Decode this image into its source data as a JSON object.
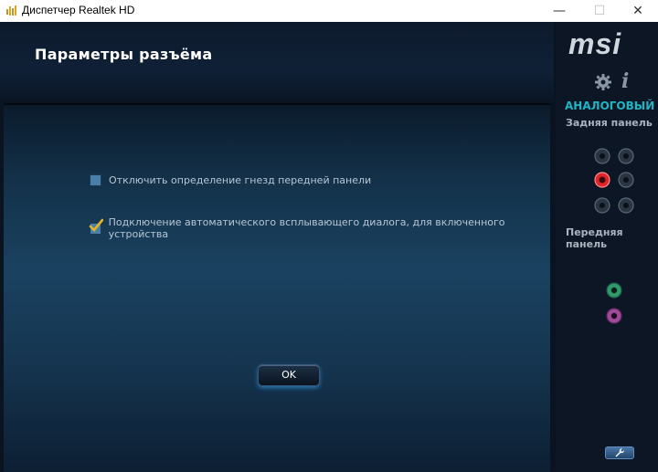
{
  "window": {
    "title": "Диспетчер Realtek HD",
    "controls": {
      "minimize": "—",
      "maximize": "☐",
      "close": "✕"
    }
  },
  "header": {
    "title": "Параметры разъёма"
  },
  "options": [
    {
      "label": "Отключить определение гнезд передней панели",
      "checked": false
    },
    {
      "label": "Подключение автоматического всплывающего диалога, для включенного устройства",
      "checked": true
    }
  ],
  "ok_button": {
    "label": "OK"
  },
  "side_panel": {
    "logo": "msi",
    "settings_icon": "gear-icon",
    "info_icon": "i",
    "section_title": "АНАЛОГОВЫЙ",
    "rear_panel_label": "Задняя панель",
    "front_panel_label": "Передняя панель",
    "colors": {
      "accent": "#1fb5c4",
      "active_jack": "#e0262b",
      "front_green": "#2e9a6a",
      "front_pink": "#a04a9c"
    }
  }
}
